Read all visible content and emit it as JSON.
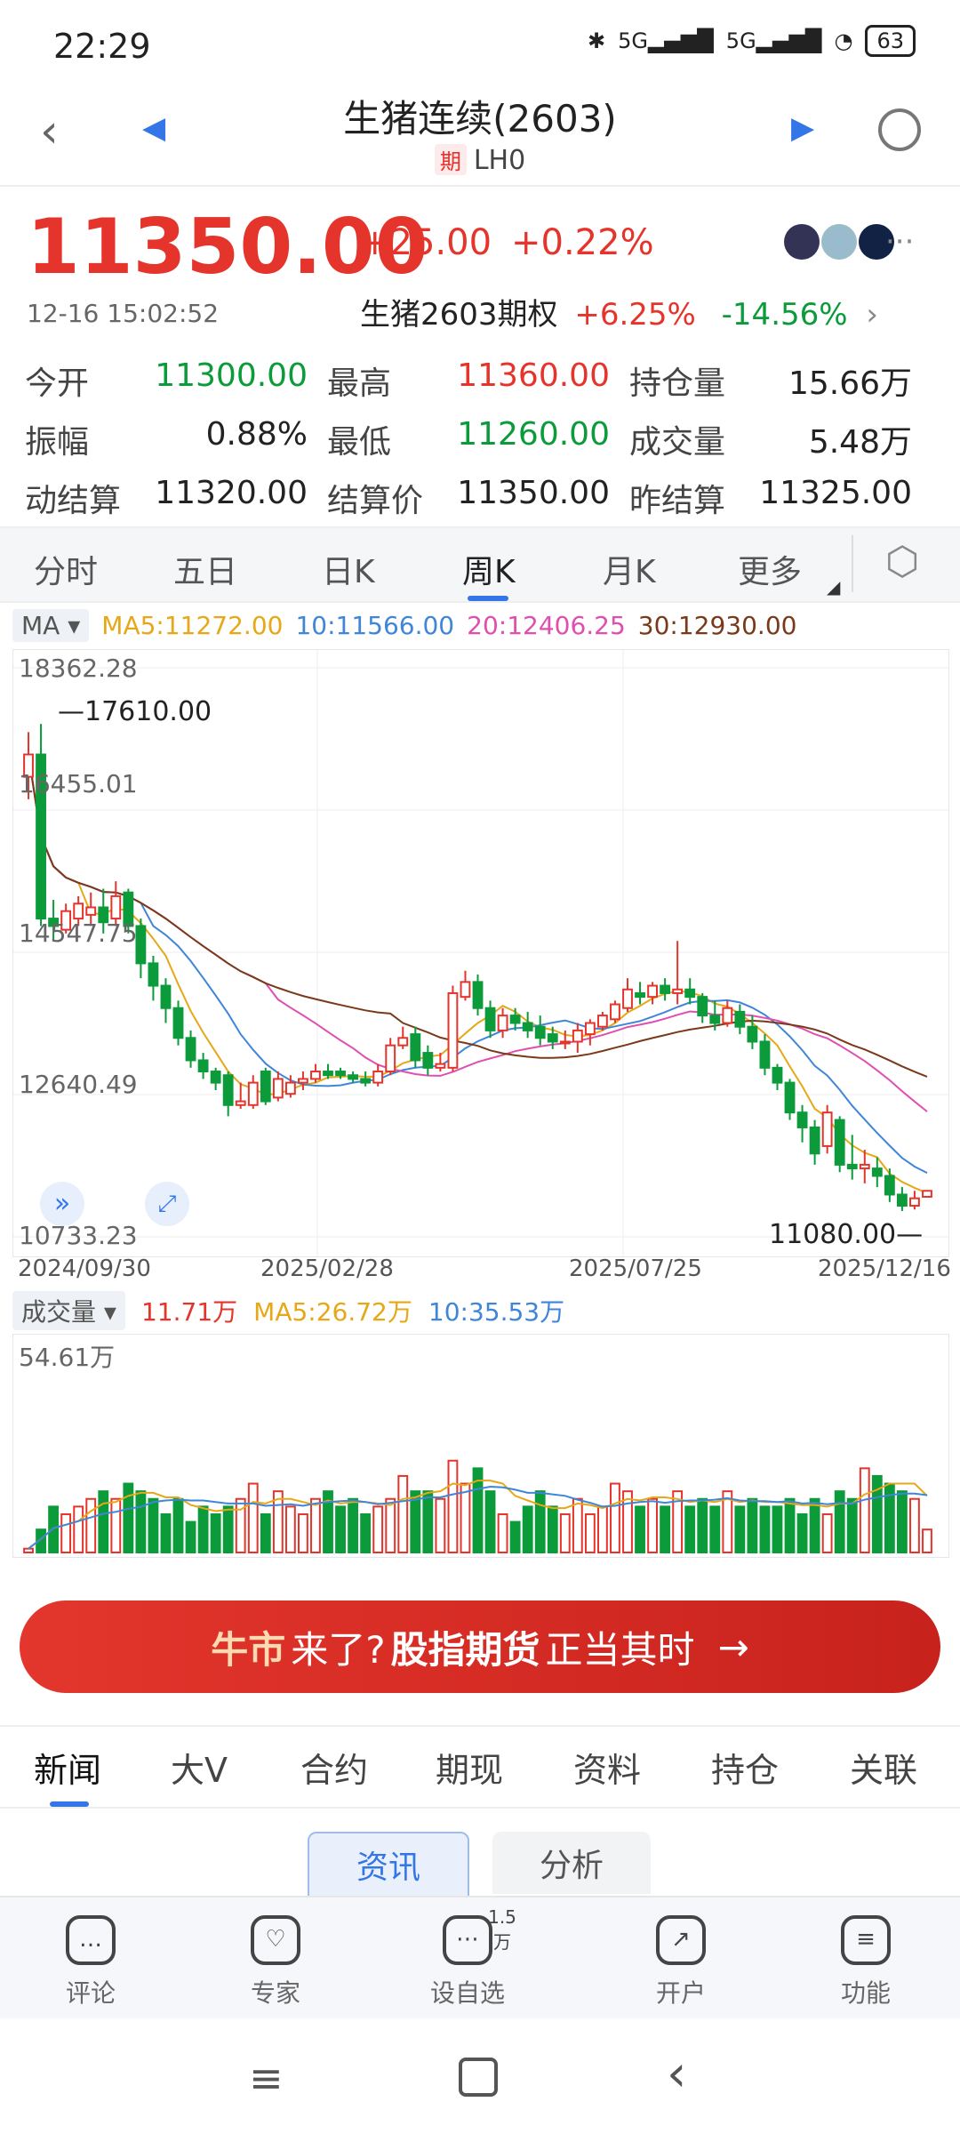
{
  "status": {
    "time": "22:29",
    "network1": "5G",
    "network2": "5G",
    "battery": "63"
  },
  "header": {
    "title": "生猪连续(2603)",
    "tag": "期",
    "code": "LH0"
  },
  "quote": {
    "price": "11350.00",
    "change": "+25.00",
    "change_pct": "+0.22%",
    "datetime": "12-16 15:02:52",
    "option_label": "生猪2603期权",
    "option_up": "+6.25%",
    "option_down": "-14.56%"
  },
  "stats": [
    [
      {
        "label": "今开",
        "value": "11300.00",
        "color": "green"
      },
      {
        "label": "最高",
        "value": "11360.00",
        "color": "red"
      },
      {
        "label": "持仓量",
        "value": "15.66万",
        "color": "black"
      }
    ],
    [
      {
        "label": "振幅",
        "value": "0.88%",
        "color": "black"
      },
      {
        "label": "最低",
        "value": "11260.00",
        "color": "green"
      },
      {
        "label": "成交量",
        "value": "5.48万",
        "color": "black"
      }
    ],
    [
      {
        "label": "动结算",
        "value": "11320.00",
        "color": "black"
      },
      {
        "label": "结算价",
        "value": "11350.00",
        "color": "black"
      },
      {
        "label": "昨结算",
        "value": "11325.00",
        "color": "black"
      }
    ]
  ],
  "tabs": [
    "分时",
    "五日",
    "日K",
    "周K",
    "月K",
    "更多"
  ],
  "ma": {
    "select": "MA",
    "ma5": "MA5:11272.00",
    "ma10": "10:11566.00",
    "ma20": "20:12406.25",
    "ma30": "30:12930.00"
  },
  "yaxis": [
    "18362.28",
    "16455.01",
    "14547.75",
    "12640.49",
    "10733.23"
  ],
  "annotations": {
    "high": "17610.00",
    "low": "11080.00"
  },
  "dates": [
    "2024/09/30",
    "2025/02/28",
    "2025/07/25",
    "2025/12/16"
  ],
  "volume": {
    "select": "成交量",
    "vol": "11.71万",
    "ma5": "MA5:26.72万",
    "ma10": "10:35.53万",
    "max": "54.61万"
  },
  "banner": {
    "p1": "牛市",
    "p2": "来了?",
    "p3": "股指期货",
    "p4": "正当其时",
    "arrow": "→"
  },
  "news_tabs": [
    "新闻",
    "大V",
    "合约",
    "期现",
    "资料",
    "持仓",
    "关联"
  ],
  "sub_tabs": [
    "资讯",
    "分析"
  ],
  "bottom_nav": [
    {
      "label": "评论",
      "icon": "comment-icon"
    },
    {
      "label": "专家",
      "icon": "expert-icon"
    },
    {
      "label": "设自选",
      "icon": "watchlist-icon",
      "badge": "1.5万"
    },
    {
      "label": "开户",
      "icon": "account-icon"
    },
    {
      "label": "功能",
      "icon": "menu-icon"
    }
  ],
  "colors": {
    "up": "#e5342b",
    "down": "#0c9b3a",
    "ma5": "#e6a817",
    "ma10": "#3f86d9",
    "ma20": "#e04fb0",
    "ma30": "#7a3a1a",
    "accent": "#3476e8"
  },
  "chart_data": {
    "type": "candlestick",
    "yrange": [
      10733.23,
      18362.28
    ],
    "volume_max": 54.61,
    "candles": [
      [
        16900,
        17200,
        17500,
        16600,
        1
      ],
      [
        17200,
        15000,
        17610,
        14900,
        6
      ],
      [
        15000,
        14900,
        15250,
        14700,
        12
      ],
      [
        14850,
        15100,
        15200,
        14800,
        10
      ],
      [
        15000,
        15200,
        15300,
        14900,
        12
      ],
      [
        15050,
        15150,
        15350,
        14900,
        14
      ],
      [
        15150,
        14950,
        15400,
        14800,
        16
      ],
      [
        15000,
        15300,
        15500,
        14900,
        14
      ],
      [
        15350,
        14900,
        15400,
        14800,
        18
      ],
      [
        14900,
        14400,
        15000,
        14200,
        16
      ],
      [
        14400,
        14100,
        14500,
        13900,
        14
      ],
      [
        14100,
        13800,
        14200,
        13600,
        10
      ],
      [
        13800,
        13400,
        13900,
        13300,
        14
      ],
      [
        13400,
        13100,
        13500,
        13000,
        8
      ],
      [
        13100,
        12950,
        13200,
        12850,
        12
      ],
      [
        12950,
        12800,
        13000,
        12700,
        10
      ],
      [
        12900,
        12500,
        12950,
        12350,
        12
      ],
      [
        12500,
        12550,
        12800,
        12450,
        14
      ],
      [
        12500,
        12800,
        12900,
        12450,
        18
      ],
      [
        12950,
        12550,
        13000,
        12500,
        10
      ],
      [
        12600,
        12850,
        12950,
        12550,
        16
      ],
      [
        12650,
        12800,
        12900,
        12600,
        12
      ],
      [
        12800,
        12850,
        12950,
        12700,
        10
      ],
      [
        12850,
        12950,
        13050,
        12800,
        14
      ],
      [
        12950,
        12900,
        13050,
        12850,
        16
      ],
      [
        12950,
        12900,
        13000,
        12850,
        12
      ],
      [
        12900,
        12850,
        12950,
        12800,
        14
      ],
      [
        12850,
        12800,
        12950,
        12750,
        10
      ],
      [
        12800,
        12950,
        13050,
        12750,
        12
      ],
      [
        12950,
        13300,
        13400,
        12900,
        14
      ],
      [
        13300,
        13400,
        13550,
        13250,
        20
      ],
      [
        13450,
        13100,
        13550,
        13000,
        16
      ],
      [
        13200,
        13000,
        13300,
        12900,
        16
      ],
      [
        13000,
        13050,
        13200,
        12950,
        14
      ],
      [
        13000,
        14000,
        14100,
        12950,
        24
      ],
      [
        13950,
        14150,
        14300,
        13900,
        18
      ],
      [
        14150,
        13800,
        14250,
        13700,
        22
      ],
      [
        13800,
        13500,
        13900,
        13400,
        16
      ],
      [
        13500,
        13700,
        13800,
        13400,
        10
      ],
      [
        13700,
        13600,
        13800,
        13500,
        8
      ],
      [
        13600,
        13500,
        13750,
        13400,
        12
      ],
      [
        13550,
        13400,
        13700,
        13300,
        16
      ],
      [
        13450,
        13350,
        13550,
        13250,
        12
      ],
      [
        13350,
        13350,
        13500,
        13250,
        10
      ],
      [
        13350,
        13500,
        13600,
        13200,
        14
      ],
      [
        13450,
        13600,
        13650,
        13300,
        10
      ],
      [
        13550,
        13700,
        13750,
        13500,
        12
      ],
      [
        13650,
        13850,
        13900,
        13600,
        18
      ],
      [
        13800,
        14050,
        14200,
        13750,
        16
      ],
      [
        14000,
        13950,
        14150,
        13850,
        12
      ],
      [
        13950,
        14100,
        14150,
        13850,
        14
      ],
      [
        14100,
        14000,
        14200,
        13900,
        12
      ],
      [
        14000,
        14050,
        14700,
        13850,
        16
      ],
      [
        14050,
        13950,
        14200,
        13850,
        12
      ],
      [
        13950,
        13700,
        14000,
        13600,
        14
      ],
      [
        13700,
        13600,
        13900,
        13500,
        12
      ],
      [
        13600,
        13800,
        13900,
        13550,
        16
      ],
      [
        13750,
        13550,
        13850,
        13450,
        12
      ],
      [
        13550,
        13350,
        13700,
        13250,
        14
      ],
      [
        13350,
        13000,
        13450,
        12900,
        12
      ],
      [
        13000,
        12800,
        13050,
        12700,
        12
      ],
      [
        12800,
        12400,
        12850,
        12300,
        14
      ],
      [
        12400,
        12200,
        12500,
        12000,
        10
      ],
      [
        12200,
        11850,
        12300,
        11700,
        14
      ],
      [
        11950,
        12400,
        12500,
        11850,
        10
      ],
      [
        12300,
        11700,
        12350,
        11600,
        16
      ],
      [
        11700,
        11650,
        12100,
        11500,
        14
      ],
      [
        11650,
        11700,
        11900,
        11450,
        22
      ],
      [
        11650,
        11550,
        11800,
        11400,
        20
      ],
      [
        11550,
        11300,
        11650,
        11200,
        18
      ],
      [
        11300,
        11150,
        11400,
        11080,
        16
      ],
      [
        11150,
        11250,
        11350,
        11100,
        14
      ],
      [
        11270,
        11350,
        11360,
        11260,
        6
      ]
    ]
  }
}
